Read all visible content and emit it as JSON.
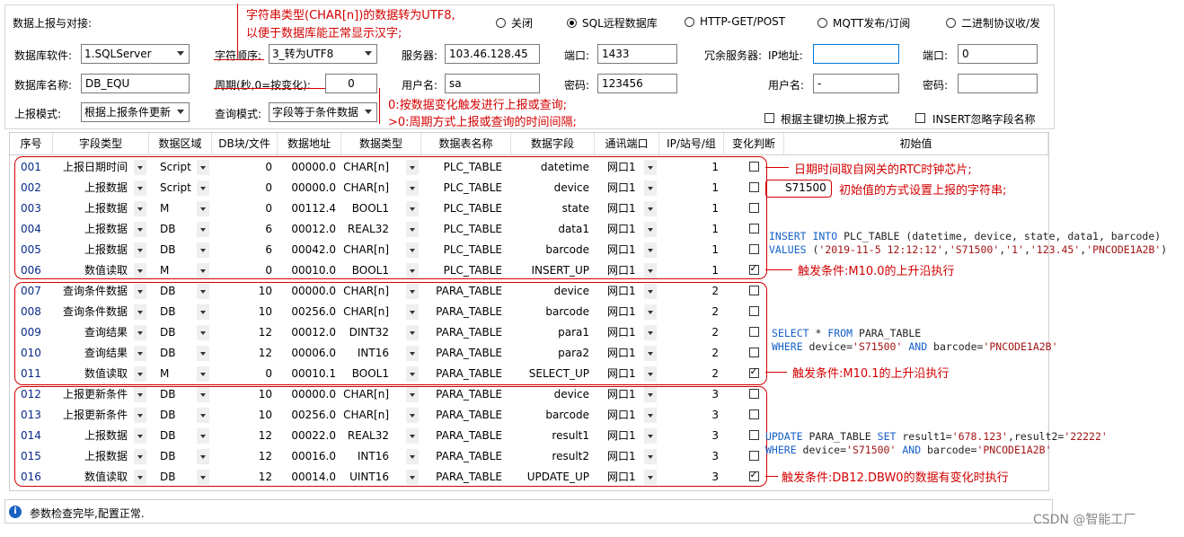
{
  "panel": {
    "title": "数据上报与对接:",
    "radios": [
      {
        "label": "关闭",
        "selected": false
      },
      {
        "label": "SQL远程数据库",
        "selected": true
      },
      {
        "label": "HTTP-GET/POST",
        "selected": false
      },
      {
        "label": "MQTT发布/订阅",
        "selected": false
      },
      {
        "label": "二进制协议收/发",
        "selected": false
      }
    ],
    "db_software_label": "数据库软件:",
    "db_software_value": "1.SQLServer",
    "char_order_label": "字符顺序:",
    "char_order_value": "3_转为UTF8",
    "server_label": "服务器:",
    "server_value": "103.46.128.45",
    "port_label": "端口:",
    "port_value": "1433",
    "redundant_label": "冗余服务器:",
    "ip_label": "IP地址:",
    "ip_value": "",
    "port2_label": "端口:",
    "port2_value": "0",
    "db_name_label": "数据库名称:",
    "db_name_value": "DB_EQU",
    "period_label": "周期(秒,0=按变化):",
    "period_value": "0",
    "user_label": "用户名:",
    "user_value": "sa",
    "pwd_label": "密码:",
    "pwd_value": "123456",
    "user2_label": "用户名:",
    "user2_value": "-",
    "pwd2_label": "密码:",
    "pwd2_value": "",
    "report_mode_label": "上报模式:",
    "report_mode_value": "根据上报条件更新",
    "query_mode_label": "查询模式:",
    "query_mode_value": "字段等于条件数据",
    "switch_label": "根据主键切换上报方式",
    "switch_checked": false,
    "ignore_label": "INSERT忽略字段名称",
    "ignore_checked": false
  },
  "grid": {
    "headers": [
      "序号",
      "字段类型",
      "数据区域",
      "DB块/文件",
      "数据地址",
      "数据类型",
      "数据表名称",
      "数据字段",
      "通讯端口",
      "IP/站号/组",
      "变化判断",
      "初始值"
    ],
    "rows": [
      [
        "001",
        "上报日期时间",
        "Script",
        "0",
        "00000.0",
        "CHAR[n]",
        "PLC_TABLE",
        "datetime",
        "网口1",
        "1",
        false,
        ""
      ],
      [
        "002",
        "上报数据",
        "Script",
        "0",
        "00000.0",
        "CHAR[n]",
        "PLC_TABLE",
        "device",
        "网口1",
        "1",
        false,
        "S71500"
      ],
      [
        "003",
        "上报数据",
        "M",
        "0",
        "00112.4",
        "BOOL1",
        "PLC_TABLE",
        "state",
        "网口1",
        "1",
        false,
        ""
      ],
      [
        "004",
        "上报数据",
        "DB",
        "6",
        "00012.0",
        "REAL32",
        "PLC_TABLE",
        "data1",
        "网口1",
        "1",
        false,
        ""
      ],
      [
        "005",
        "上报数据",
        "DB",
        "6",
        "00042.0",
        "CHAR[n]",
        "PLC_TABLE",
        "barcode",
        "网口1",
        "1",
        false,
        ""
      ],
      [
        "006",
        "数值读取",
        "M",
        "0",
        "00010.0",
        "BOOL1",
        "PLC_TABLE",
        "INSERT_UP",
        "网口1",
        "1",
        true,
        ""
      ],
      [
        "007",
        "查询条件数据",
        "DB",
        "10",
        "00000.0",
        "CHAR[n]",
        "PARA_TABLE",
        "device",
        "网口1",
        "2",
        false,
        ""
      ],
      [
        "008",
        "查询条件数据",
        "DB",
        "10",
        "00256.0",
        "CHAR[n]",
        "PARA_TABLE",
        "barcode",
        "网口1",
        "2",
        false,
        ""
      ],
      [
        "009",
        "查询结果",
        "DB",
        "12",
        "00012.0",
        "DINT32",
        "PARA_TABLE",
        "para1",
        "网口1",
        "2",
        false,
        ""
      ],
      [
        "010",
        "查询结果",
        "DB",
        "12",
        "00006.0",
        "INT16",
        "PARA_TABLE",
        "para2",
        "网口1",
        "2",
        false,
        ""
      ],
      [
        "011",
        "数值读取",
        "M",
        "0",
        "00010.1",
        "BOOL1",
        "PARA_TABLE",
        "SELECT_UP",
        "网口1",
        "2",
        true,
        ""
      ],
      [
        "012",
        "上报更新条件",
        "DB",
        "10",
        "00000.0",
        "CHAR[n]",
        "PARA_TABLE",
        "device",
        "网口1",
        "3",
        false,
        ""
      ],
      [
        "013",
        "上报更新条件",
        "DB",
        "10",
        "00256.0",
        "CHAR[n]",
        "PARA_TABLE",
        "barcode",
        "网口1",
        "3",
        false,
        ""
      ],
      [
        "014",
        "上报数据",
        "DB",
        "12",
        "00022.0",
        "REAL32",
        "PARA_TABLE",
        "result1",
        "网口1",
        "3",
        false,
        ""
      ],
      [
        "015",
        "上报数据",
        "DB",
        "12",
        "00016.0",
        "INT16",
        "PARA_TABLE",
        "result2",
        "网口1",
        "3",
        false,
        ""
      ],
      [
        "016",
        "数值读取",
        "DB",
        "12",
        "00014.0",
        "UINT16",
        "PARA_TABLE",
        "UPDATE_UP",
        "网口1",
        "3",
        true,
        ""
      ]
    ]
  },
  "annotations": {
    "char_note_1": "字符串类型(CHAR[n])的数据转为UTF8,",
    "char_note_2": "以便于数据库能正常显示汉字;",
    "period_note_1": "0:按数据变化触发进行上报或查询;",
    "period_note_2": ">0:周期方式上报或查询的时间间隔;",
    "datetime_note": "日期时间取自网关的RTC时钟芯片;",
    "init_note": "初始值的方式设置上报的字符串;",
    "trigger1": "触发条件:M10.0的上升沿执行",
    "trigger2": "触发条件:M10.1的上升沿执行",
    "trigger3": "触发条件:DB12.DBW0的数据有变化时执行"
  },
  "sql": {
    "insert_1": [
      "INSERT INTO",
      " PLC_TABLE (datetime, device, state, data1, barcode)"
    ],
    "insert_2": [
      "VALUES",
      " (",
      "'2019-11-5 12:12:12'",
      ",",
      "'S71500'",
      ",",
      "'1'",
      ",",
      "'123.45'",
      ",",
      "'PNCODE1A2B'",
      ")"
    ],
    "select_1": [
      "SELECT",
      " * ",
      "FROM",
      " PARA_TABLE"
    ],
    "select_2": [
      "WHERE",
      " device=",
      "'S71500'",
      " ",
      "AND",
      " barcode=",
      "'PNCODE1A2B'"
    ],
    "update_1": [
      "UPDATE",
      " PARA_TABLE ",
      "SET",
      " result1=",
      "'678.123'",
      ",result2=",
      "'22222'"
    ],
    "update_2": [
      "WHERE",
      " device=",
      "'S71500'",
      " ",
      "AND",
      " barcode=",
      "'PNCODE1A2B'"
    ]
  },
  "status": {
    "text": "参数检查完毕,配置正常."
  },
  "watermark": "CSDN @智能工厂"
}
